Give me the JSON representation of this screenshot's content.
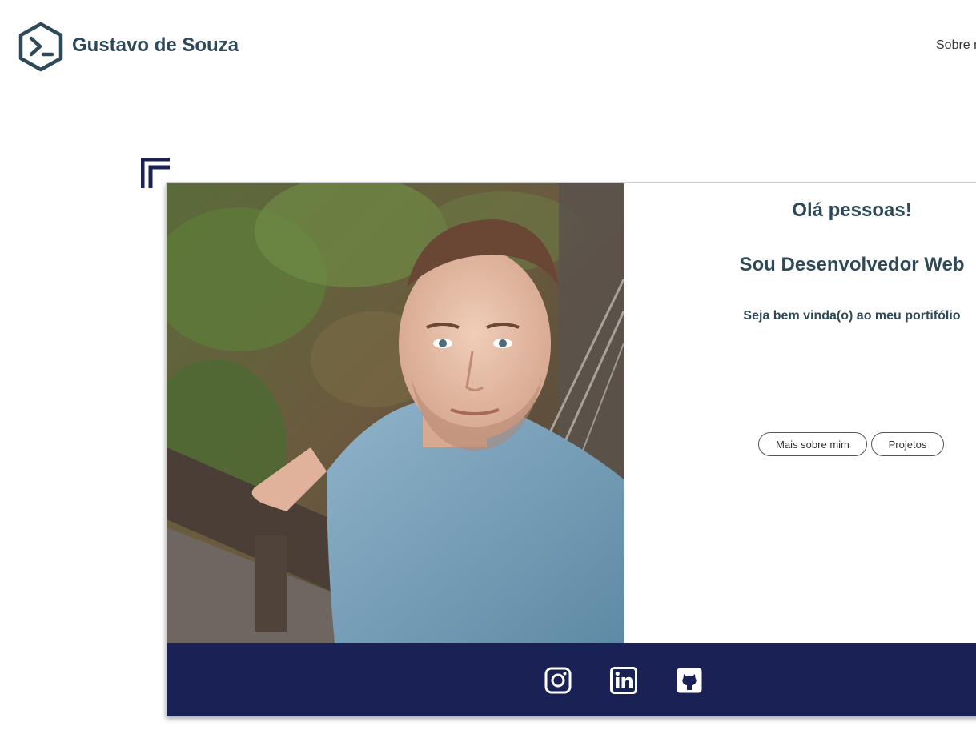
{
  "header": {
    "brand_name": "Gustavo de Souza",
    "logo_icon": "terminal-prompt-hexagon-icon",
    "nav": {
      "about_link": "Sobre mim"
    }
  },
  "intro": {
    "greeting": "Olá pessoas!",
    "role": "Sou Desenvolvedor Web",
    "welcome": "Seja bem vinda(o) ao meu portifólio",
    "buttons": {
      "more_about": "Mais sobre mim",
      "projects": "Projetos"
    }
  },
  "social": {
    "icons": [
      "instagram-icon",
      "linkedin-icon",
      "github-icon"
    ]
  },
  "colors": {
    "brand_text": "#2e4a5a",
    "footer_bar": "#1a2155",
    "corner_decoration": "#1a2155"
  }
}
